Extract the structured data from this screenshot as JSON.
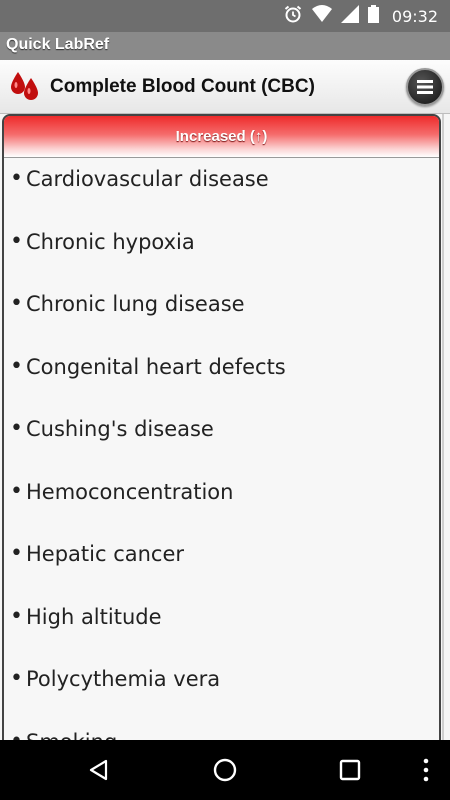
{
  "status_bar": {
    "time": "09:32",
    "icons": [
      "alarm-icon",
      "wifi-icon",
      "signal-icon",
      "battery-icon"
    ]
  },
  "app_bar": {
    "title": "Quick LabRef"
  },
  "header": {
    "title": "Complete Blood Count (CBC)",
    "logo_icon": "blood-drops-icon",
    "menu_icon": "menu-icon"
  },
  "section": {
    "title": "Increased (↑)",
    "bullet": "•",
    "items": [
      "Cardiovascular disease",
      "Chronic hypoxia",
      "Chronic lung disease",
      "Congenital heart defects",
      "Cushing's disease",
      "Hemoconcentration",
      "Hepatic cancer",
      "High altitude",
      "Polycythemia vera",
      "Smoking"
    ]
  },
  "nav_bar": {
    "icons": [
      "back-icon",
      "home-icon",
      "recents-icon",
      "more-icon"
    ]
  },
  "colors": {
    "section_red": "#ee2b2b",
    "status_bar": "#6e6e6e",
    "app_bar": "#8a8a8a"
  }
}
